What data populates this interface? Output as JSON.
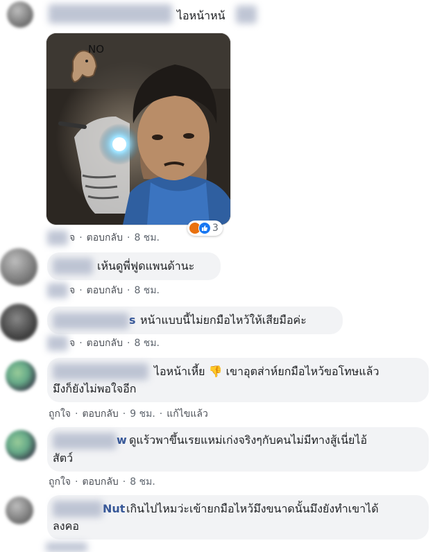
{
  "comments": [
    {
      "text_suffix": "ไอหน้าหน้",
      "has_photo": true,
      "photo_caption": "NO",
      "reaction_count": "3",
      "reactions": [
        "angry",
        "like"
      ],
      "like_label": "จ",
      "reply_label": "ตอบกลับ",
      "time": "8 ชม."
    },
    {
      "text": "เห้นดูพี่ฟูดแพนด้านะ",
      "like_label": "จ",
      "reply_label": "ตอบกลับ",
      "time": "8 ชม."
    },
    {
      "name_suffix": "s",
      "text": "หน้าแบบนี้ไม่ยกมือไหว้ให้เสียมือค่ะ",
      "like_label": "จ",
      "reply_label": "ตอบกลับ",
      "time": "8 ชม."
    },
    {
      "text_line1": "ไอหน้าเหี้ย",
      "emoji": "👎",
      "text_line1b": "เขาอุตส่าห์ยกมือไหว้ขอโทษแล้ว",
      "text_line2": "มึงก็ยังไม่พอใจอีก",
      "like_label": "ถูกใจ",
      "reply_label": "ตอบกลับ",
      "time": "9 ชม.",
      "edited_label": "แก้ไขแล้ว"
    },
    {
      "name_suffix": "w",
      "text_line1": "ดูแร้วพาขึ้นเรยแหม่เก่งจริงๆกับคนไม่มีทางสู้เนี่ยไอ้",
      "text_line2": "สัตว์",
      "like_label": "ถูกใจ",
      "reply_label": "ตอบกลับ",
      "time": "8 ชม."
    },
    {
      "name_suffix": "Nut",
      "text_line1": "เกินไปไหมว่ะเข้ายกมือไหว้มึงขนาดนั้นมึงยังทำเขาได้",
      "text_line2": "ลงคอ"
    }
  ],
  "colors": {
    "bubble": "#f2f3f5",
    "name": "#385898",
    "meta": "#606770"
  }
}
